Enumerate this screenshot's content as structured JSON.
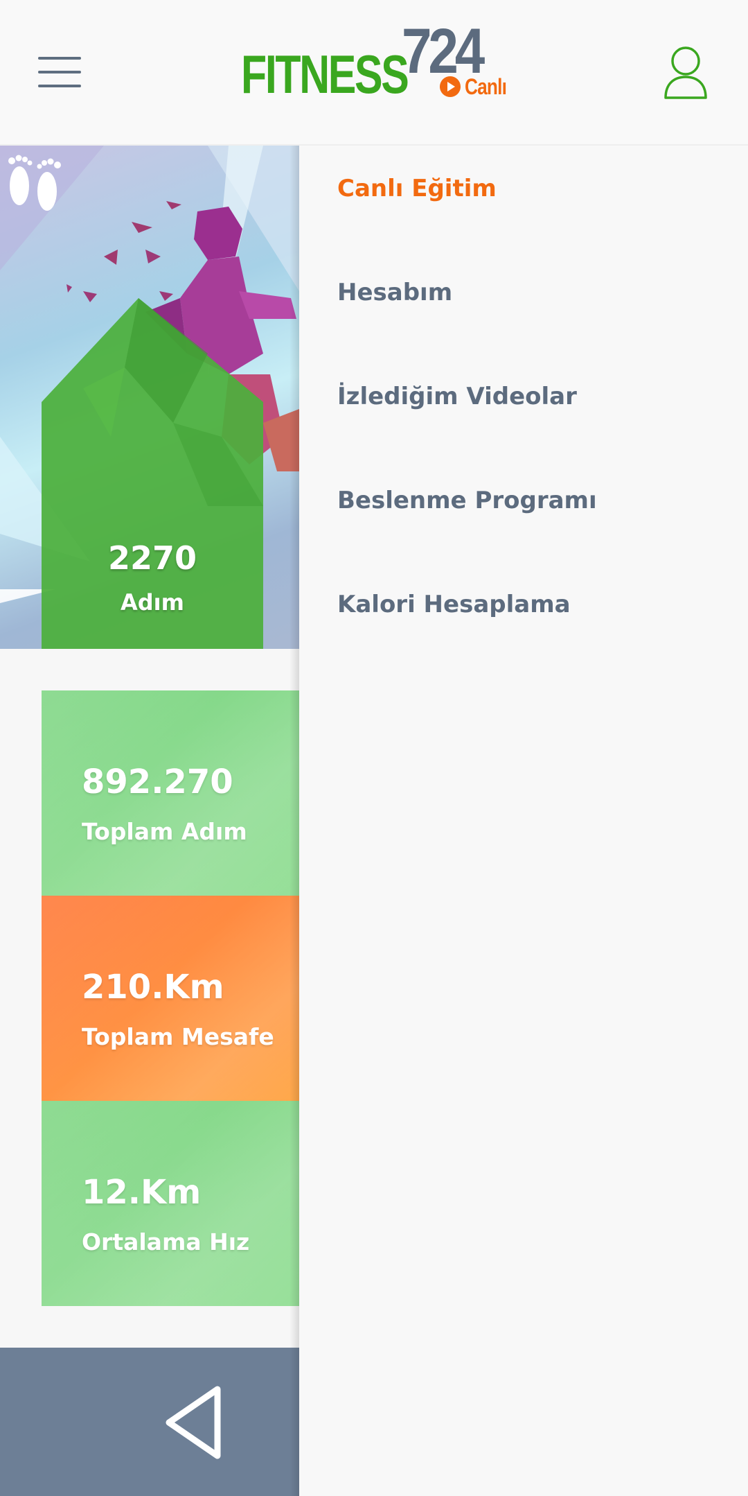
{
  "header": {
    "logo": {
      "word": "FITNESS",
      "number": "724",
      "live_label": "Canlı"
    },
    "menu_icon": "hamburger-menu-icon",
    "profile_icon": "user-profile-icon"
  },
  "hero": {
    "icon": "footprints-icon",
    "steps_value": "2270",
    "steps_label": "Adım"
  },
  "stats": [
    {
      "value": "892.270",
      "label": "Toplam Adım"
    },
    {
      "value": "210.Km",
      "label": "Toplam Mesafe"
    },
    {
      "value": "12.Km",
      "label": "Ortalama Hız"
    }
  ],
  "drawer": {
    "items": [
      {
        "label": "Canlı Eğitim",
        "active": true
      },
      {
        "label": "Hesabım",
        "active": false
      },
      {
        "label": "İzlediğim Videolar",
        "active": false
      },
      {
        "label": "Beslenme Programı",
        "active": false
      },
      {
        "label": "Kalori Hesaplama",
        "active": false
      }
    ]
  },
  "bottom_nav": {
    "back_icon": "back-triangle-icon"
  },
  "colors": {
    "brand_green": "#3aa71f",
    "brand_orange": "#f26a10",
    "text_slate": "#5c6b7e",
    "nav_bar": "#6d7f96"
  }
}
